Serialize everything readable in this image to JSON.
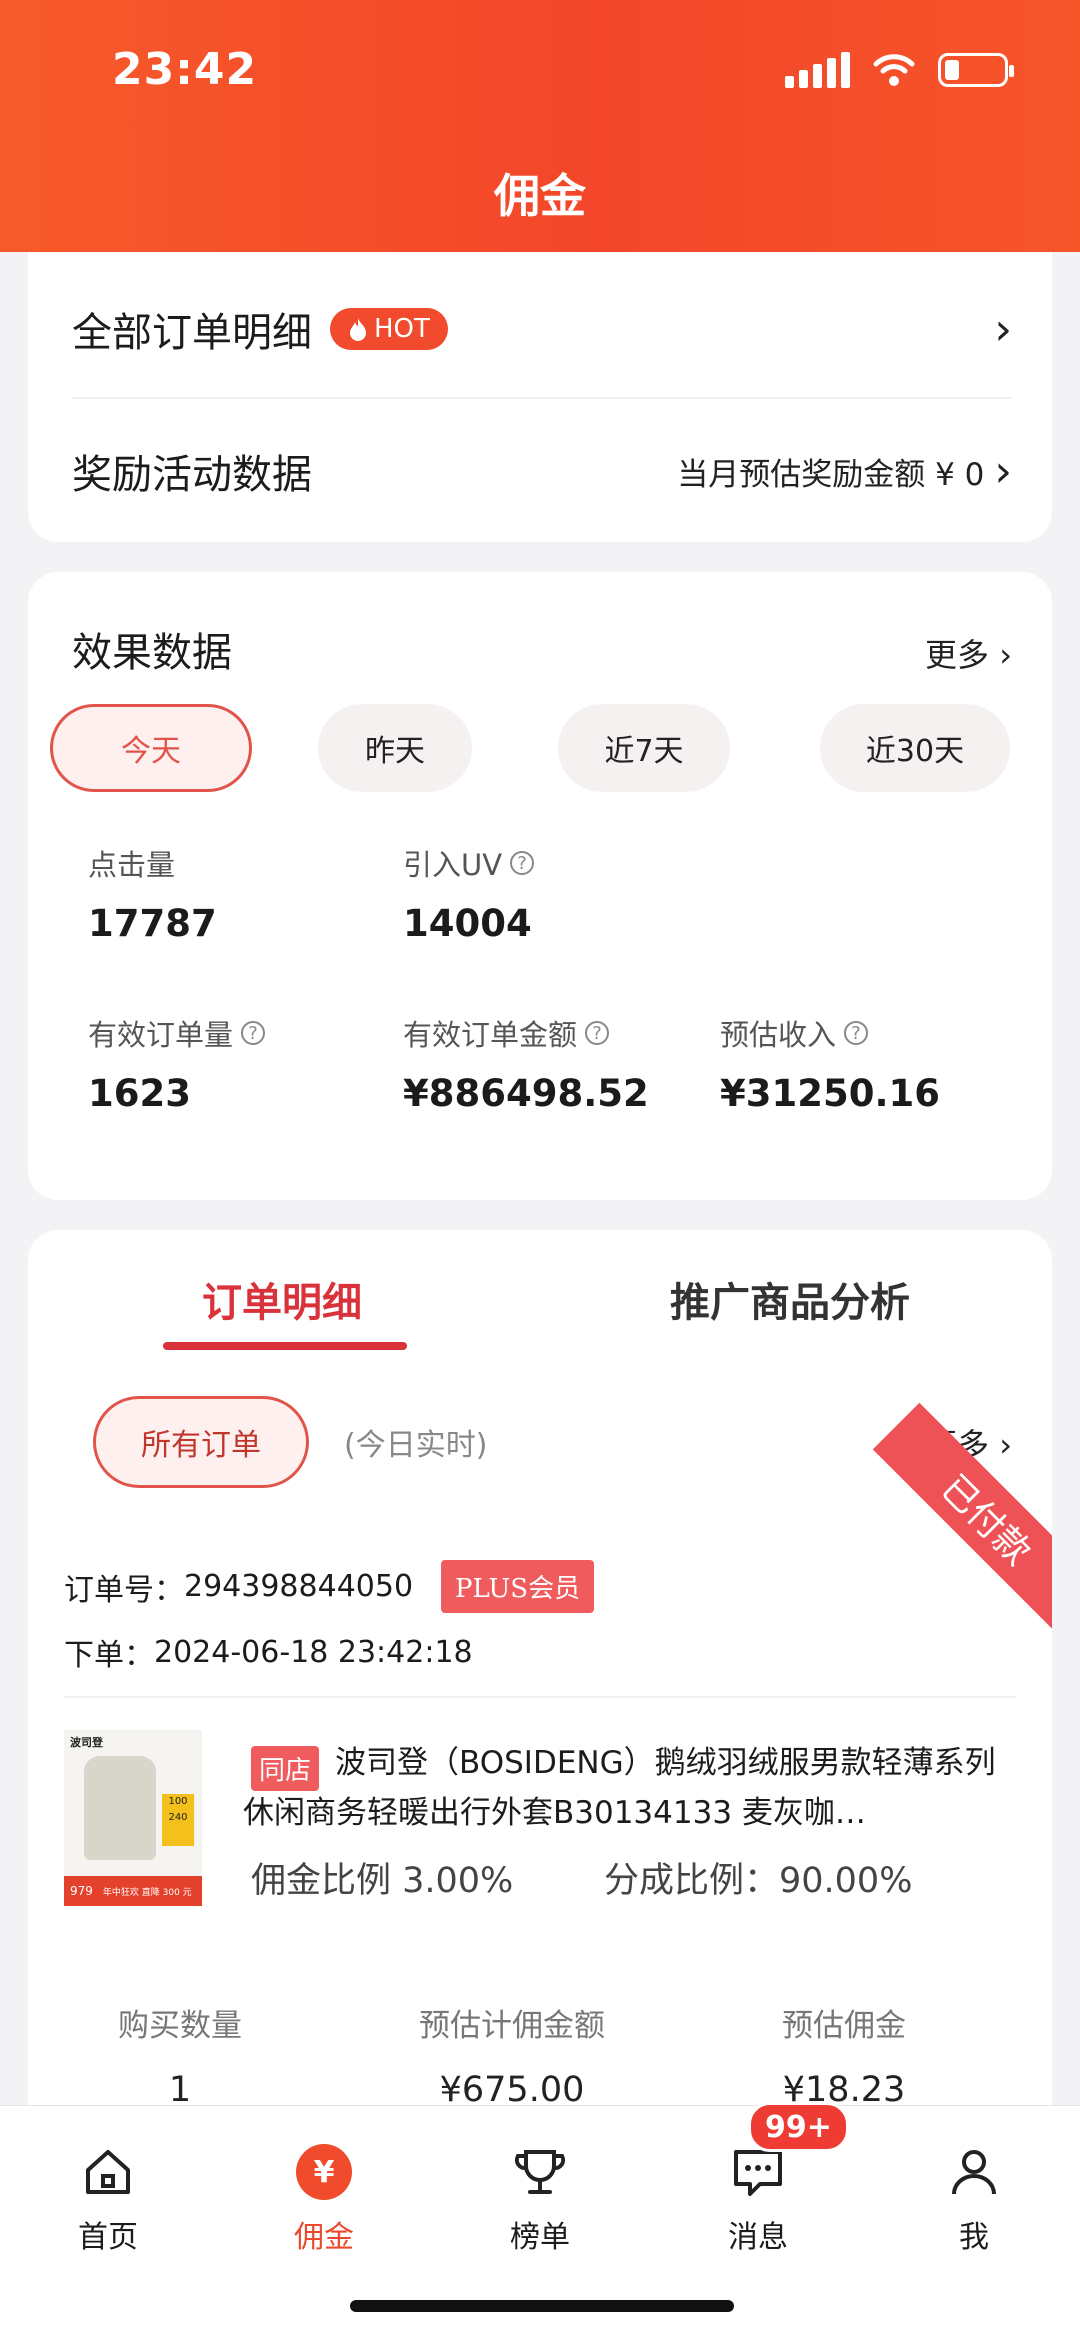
{
  "status_bar": {
    "time": "23:42"
  },
  "header": {
    "title": "佣金"
  },
  "menu": {
    "all_orders": {
      "label": "全部订单明细",
      "hot_badge": "HOT"
    },
    "reward": {
      "label": "奖励活动数据",
      "right_text": "当月预估奖励金额 ¥ 0"
    }
  },
  "effect": {
    "title": "效果数据",
    "more": "更多 ›",
    "periods": [
      "今天",
      "昨天",
      "近7天",
      "近30天"
    ],
    "selected_period": "今天",
    "metrics": {
      "clicks": {
        "label": "点击量",
        "value": "17787"
      },
      "uv": {
        "label": "引入UV",
        "value": "14004"
      },
      "valid_orders": {
        "label": "有效订单量",
        "value": "1623"
      },
      "valid_amount": {
        "label": "有效订单金额",
        "value": "¥886498.52"
      },
      "est_income": {
        "label": "预估收入",
        "value": "¥31250.16"
      }
    }
  },
  "orders": {
    "tabs": [
      "订单明细",
      "推广商品分析"
    ],
    "active_tab": "订单明细",
    "filter": "所有订单",
    "realtime_note": "(今日实时)",
    "more": "更多 ›",
    "item": {
      "status": "已付款",
      "order_no_label": "订单号：",
      "order_no": "294398844050",
      "member_badge": "PLUS会员",
      "placed_label": "下单：",
      "placed_time": "2024-06-18 23:42:18",
      "store_badge": "同店",
      "product_title": "波司登（BOSIDENG）鹅绒羽绒服男款轻薄系列休闲商务轻暖出行外套B30134133 麦灰咖…",
      "commission_rate": "佣金比例 3.00%",
      "share_rate": "分成比例：90.00%",
      "image": {
        "brand": "波司登",
        "price": "979",
        "tag_top": "100",
        "tag_bottom": "240",
        "promo": "年中狂欢 直降 300 元"
      },
      "columns": [
        {
          "label": "购买数量",
          "value": "1"
        },
        {
          "label": "预估计佣金额",
          "value": "¥675.00"
        },
        {
          "label": "预估佣金",
          "value": "¥18.23"
        }
      ]
    }
  },
  "tabbar": {
    "items": [
      {
        "label": "首页",
        "icon": "home-icon"
      },
      {
        "label": "佣金",
        "icon": "yen-icon"
      },
      {
        "label": "榜单",
        "icon": "trophy-icon"
      },
      {
        "label": "消息",
        "icon": "message-icon"
      },
      {
        "label": "我",
        "icon": "person-icon"
      }
    ],
    "active": "佣金",
    "message_badge": "99+"
  },
  "colors": {
    "accent": "#f3462a",
    "active_red": "#d9323a",
    "badge_red": "#f05b5e"
  }
}
